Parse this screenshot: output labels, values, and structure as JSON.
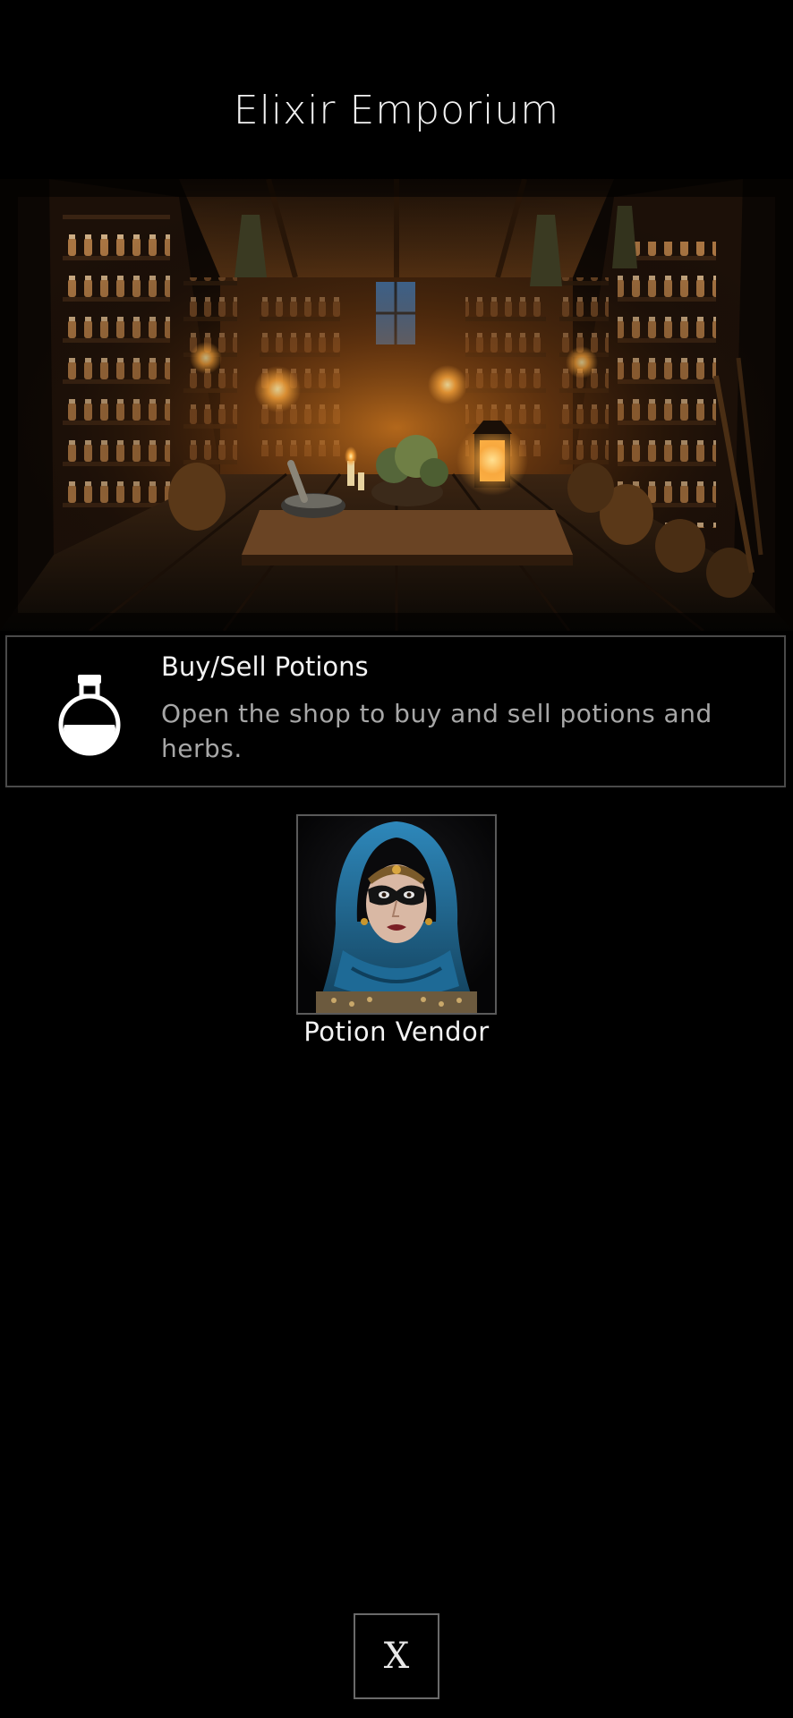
{
  "header": {
    "title": "Elixir Emporium"
  },
  "scene": {
    "description_icon": "apothecary-shop-illustration"
  },
  "action": {
    "icon": "potion-flask-icon",
    "title": "Buy/Sell Potions",
    "description": "Open the shop to buy and sell potions and herbs."
  },
  "npc": {
    "name": "Potion Vendor",
    "icon": "hooded-woman-portrait"
  },
  "footer": {
    "close_label": "X"
  },
  "colors": {
    "background": "#000000",
    "card_border": "#4a4a4a",
    "description_text": "#a7a7a7",
    "lantern_glow": "#f5a23a",
    "hood_blue": "#1d5f86"
  }
}
